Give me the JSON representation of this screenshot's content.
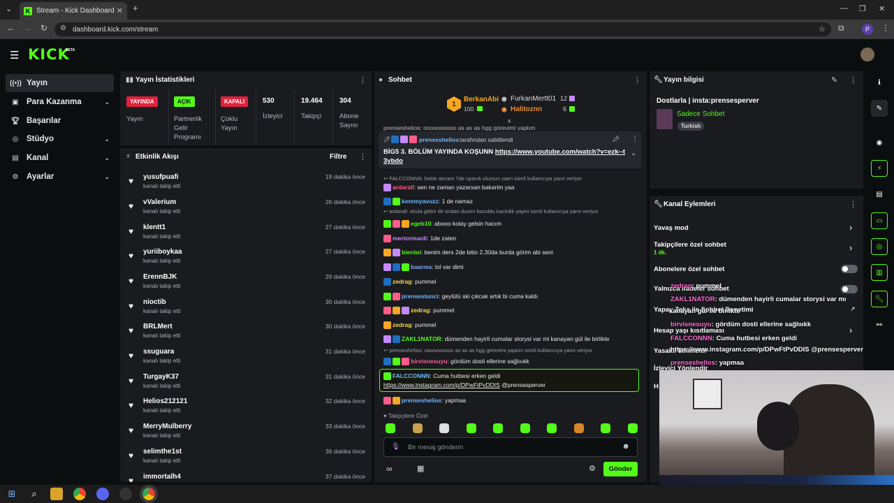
{
  "browser": {
    "tab_title": "Stream - Kick Dashboard",
    "url": "dashboard.kick.com/stream",
    "profile_initial": "P"
  },
  "brand": {
    "logo": "KICK",
    "beta": "BETA",
    "accent": "#53fc18"
  },
  "sidebar": {
    "items": [
      {
        "label": "Yayın",
        "icon": "broadcast-icon"
      },
      {
        "label": "Para Kazanma",
        "icon": "money-icon"
      },
      {
        "label": "Başarılar",
        "icon": "trophy-icon"
      },
      {
        "label": "Stüdyo",
        "icon": "studio-icon"
      },
      {
        "label": "Kanal",
        "icon": "channel-icon"
      },
      {
        "label": "Ayarlar",
        "icon": "gear-icon"
      }
    ]
  },
  "stats": {
    "title": "Yayın İstatistikleri",
    "cols": [
      {
        "badge": "YAYINDA",
        "label": "Yayın"
      },
      {
        "badge": "AÇIK",
        "label": "Partnerlik Gelir Programı"
      },
      {
        "badge": "KAPALI",
        "label": "Çoklu Yayın"
      },
      {
        "value": "530",
        "label": "İzleyici"
      },
      {
        "value": "19.464",
        "label": "Takipçi"
      },
      {
        "value": "304",
        "label": "Abone Sayısı"
      }
    ]
  },
  "activity": {
    "title": "Etkinlik Akışı",
    "filter": "Filtre",
    "follow_text": "kanalı takip etti",
    "events": [
      {
        "user": "yusufpuafi",
        "time": "19 dakika önce"
      },
      {
        "user": "vValerium",
        "time": "26 dakika önce"
      },
      {
        "user": "klentt1",
        "time": "27 dakika önce"
      },
      {
        "user": "yuriiboykaa",
        "time": "27 dakika önce"
      },
      {
        "user": "ErennBJK",
        "time": "29 dakika önce"
      },
      {
        "user": "nioctib",
        "time": "30 dakika önce"
      },
      {
        "user": "BRLMert",
        "time": "30 dakika önce"
      },
      {
        "user": "ssuguara",
        "time": "31 dakika önce"
      },
      {
        "user": "TurgayK37",
        "time": "31 dakika önce"
      },
      {
        "user": "Helios212121",
        "time": "32 dakika önce"
      },
      {
        "user": "MerryMulberry",
        "time": "33 dakika önce"
      },
      {
        "user": "selimthe1st",
        "time": "36 dakika önce"
      },
      {
        "user": "immortalh4",
        "time": "37 dakika önce"
      }
    ]
  },
  "chat": {
    "title": "Sohbet",
    "top_gifters": [
      {
        "rank": "1",
        "name": "BerkanAbi",
        "count": "100"
      },
      {
        "name": "FurkanMertt01",
        "count": "12"
      },
      {
        "name": "Halitoznn",
        "count": "6"
      }
    ],
    "pinned": {
      "by_user": "prenseshelios",
      "by_text": "tarafından sabitlendi",
      "message_prefix": "BİG5 3. BÖLÜM YAYINDA KOŞUNN ",
      "link": "https://www.youtube.com/watch?v=ezk--t3ybdo"
    },
    "scroll_hint": "prenseshelios: oooooooooo as as as hgg görevimi yaptım",
    "messages": [
      {
        "reply": "FALCCONNN: bekle atıcam 7de uyanık olursun zaen isimli kullanıcıya yanıt veriyor",
        "user": "ardarall",
        "color": "#ff5c8a",
        "text": "sen ne zaman yazarsan bakarim yaa"
      },
      {
        "user": "keremyavuzz",
        "color": "#6fb6ff",
        "text": "1 de namaz"
      },
      {
        "reply": "ardarall: okula gittim de ondan duzen bozuldu kacirdik yayini isimli kullanıcıya yanıt veriyor",
        "user": "egeb10",
        "color": "#53fc18",
        "text": "abooo kolay gelsin hacım"
      },
      {
        "user": "mertormanli",
        "color": "#c58af9",
        "text": "1de zaten"
      },
      {
        "user": "bientoi",
        "color": "#53fc18",
        "text": "benim ders 2de bitio 2.30da burda görim abi seni"
      },
      {
        "user": "baarma",
        "color": "#7ea6ff",
        "text": "lol var dimi"
      },
      {
        "user": "zedrag",
        "color": "#ffd84d",
        "text": "pummel"
      },
      {
        "user": "prensestunci",
        "color": "#6fb6ff",
        "text": "geylülü ski çıkcak artık bi cuma kaldı"
      },
      {
        "user": "zedrag",
        "color": "#ffd84d",
        "text": "pummel"
      },
      {
        "user": "zedrag",
        "color": "#ffd84d",
        "text": "pummel"
      },
      {
        "user": "ZAKL1NATOR",
        "color": "#53fc18",
        "text": "dümenden hayirli cumalar storysi var mi kanayan gül ile birlikte"
      },
      {
        "reply": "prenseshelios: oooooooooo as as as hgg görevimi yaptım isimli kullanıcıya yanıt veriyor",
        "user": "birvisnesuyu",
        "color": "#ff5c8a",
        "text": "gördüm dosti ellerine sağlıııkk"
      },
      {
        "user": "FALCCONNN",
        "color": "#6fb6ff",
        "text": "Cuma hutbesi erken geldi",
        "link": "https://www.instagram.com/p/DPwFtPvDDIS",
        "after": " @prensesperver",
        "highlight": true
      },
      {
        "user": "prenseshelios",
        "color": "#6fb6ff",
        "text": "yapmaa"
      }
    ],
    "followers_only": "Takipçilere Özel",
    "input_placeholder": "Bir mesaj gönderin",
    "send": "Gönder"
  },
  "stream_info": {
    "title": "Yayın bilgisi",
    "stream_title": "Dostlarla | insta:prensesperver",
    "category": "Sadece Sohbet",
    "tag": "Turkish"
  },
  "channel_actions": {
    "title": "Kanal Eylemleri",
    "slow_mode": "Yavaş mod",
    "followers_chat": "Takipçilere özel sohbet",
    "followers_sub": "1 dk.",
    "subs_chat": "Abonelere özel sohbet",
    "emote_only": "Yalnızca ifadeler sohbet",
    "ai_moderation": "Yapay Zeka ile Sohbet Denetimi",
    "age_limits": "Hesap yaşı kısıtlaması",
    "banned_words": "Yasaklı kelimeler",
    "viewer_redirect": "İzleyici Yönlendir",
    "last_item": "H"
  },
  "overlay_chat": [
    {
      "user": "zedrag",
      "text": ": pummel"
    },
    {
      "user": "ZAKL1NATOR",
      "text": ": dümenden hayirli cumalar storysi var mı"
    },
    {
      "user": "",
      "text": "kanayan gül ile birlikte"
    },
    {
      "user": "birvisnesuyu",
      "text": ": gördüm dosti ellerine sağlıııkk"
    },
    {
      "user": "FALCCONNN",
      "text": ": Cuma hutbesi erken geldi"
    },
    {
      "user": "",
      "text": "https://www.instagram.com/p/DPwFtPvDDIS @prensesperver"
    },
    {
      "user": "prenseshelios",
      "text": ": yapmaa"
    }
  ]
}
